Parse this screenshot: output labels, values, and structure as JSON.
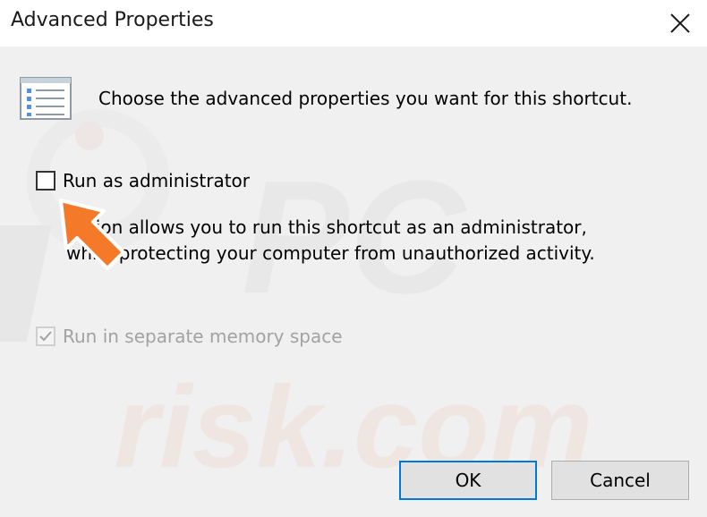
{
  "window": {
    "title": "Advanced Properties"
  },
  "dialog": {
    "description": "Choose the advanced properties you want for this shortcut.",
    "run_as_admin": {
      "label": "Run as administrator",
      "checked": false
    },
    "help_text": "option allows you to run this shortcut as an administrator,\nwhile protecting your computer from unauthorized activity.",
    "separate_memory": {
      "label": "Run in separate memory space",
      "checked": true,
      "disabled": true
    }
  },
  "buttons": {
    "ok": "OK",
    "cancel": "Cancel"
  },
  "colors": {
    "accent": "#0078d7",
    "annotation_arrow": "#f47a2a"
  },
  "icons": {
    "close": "close-icon",
    "properties": "properties-list-icon",
    "check": "checkmark-icon",
    "arrow": "annotation-arrow"
  },
  "watermark": {
    "text": "PC risk.com"
  }
}
